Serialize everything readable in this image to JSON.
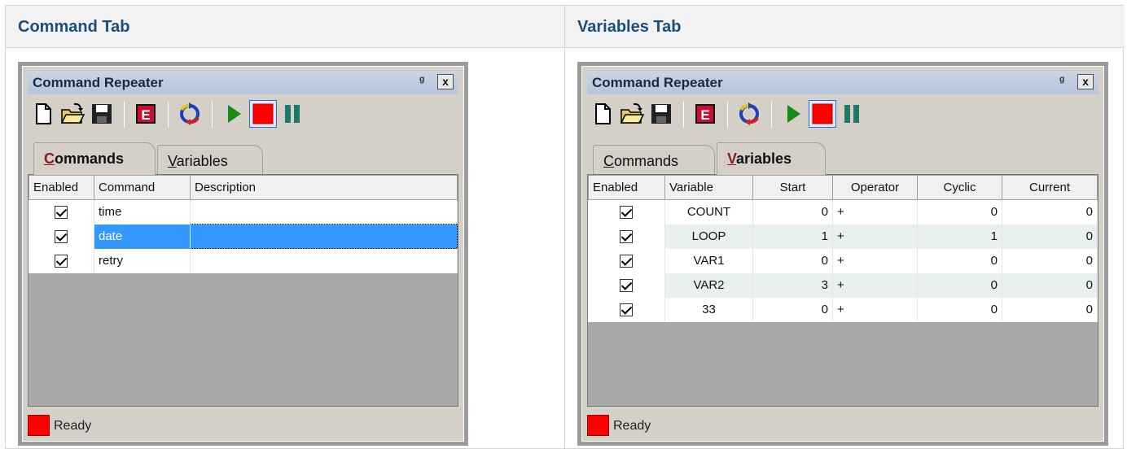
{
  "headers": {
    "left": "Command Tab",
    "right": "Variables Tab"
  },
  "window_title": "Command Repeater",
  "title_pin": "ᵍ",
  "title_close": "x",
  "toolbar": [
    "new-file-icon",
    "open-folder-icon",
    "save-disk-icon",
    "edit-e-icon",
    "refresh-cycle-icon",
    "play-icon",
    "stop-icon",
    "pause-icon"
  ],
  "tabs": {
    "commands": {
      "underline": "C",
      "rest": "ommands"
    },
    "variables": {
      "underline": "V",
      "rest": "ariables"
    }
  },
  "commands_grid": {
    "columns": [
      "Enabled",
      "Command",
      "Description"
    ],
    "rows": [
      {
        "enabled": true,
        "command": "time",
        "description": ""
      },
      {
        "enabled": true,
        "command": "date",
        "description": ""
      },
      {
        "enabled": true,
        "command": "retry",
        "description": ""
      }
    ]
  },
  "variables_grid": {
    "columns": [
      "Enabled",
      "Variable",
      "Start",
      "Operator",
      "Cyclic",
      "Current"
    ],
    "rows": [
      {
        "enabled": true,
        "variable": "COUNT",
        "start": "0",
        "operator": "+",
        "cyclic": "0",
        "current": "0"
      },
      {
        "enabled": true,
        "variable": "LOOP",
        "start": "1",
        "operator": "+",
        "cyclic": "1",
        "current": "0"
      },
      {
        "enabled": true,
        "variable": "VAR1",
        "start": "0",
        "operator": "+",
        "cyclic": "0",
        "current": "0"
      },
      {
        "enabled": true,
        "variable": "VAR2",
        "start": "3",
        "operator": "+",
        "cyclic": "0",
        "current": "0"
      },
      {
        "enabled": true,
        "variable": "33",
        "start": "0",
        "operator": "+",
        "cyclic": "0",
        "current": "0"
      }
    ]
  },
  "status": {
    "text": "Ready",
    "color": "#ff0000"
  },
  "colors": {
    "header_text": "#1b4f7a",
    "selection": "#3399ff",
    "title_bar": "#b5c5dd"
  }
}
